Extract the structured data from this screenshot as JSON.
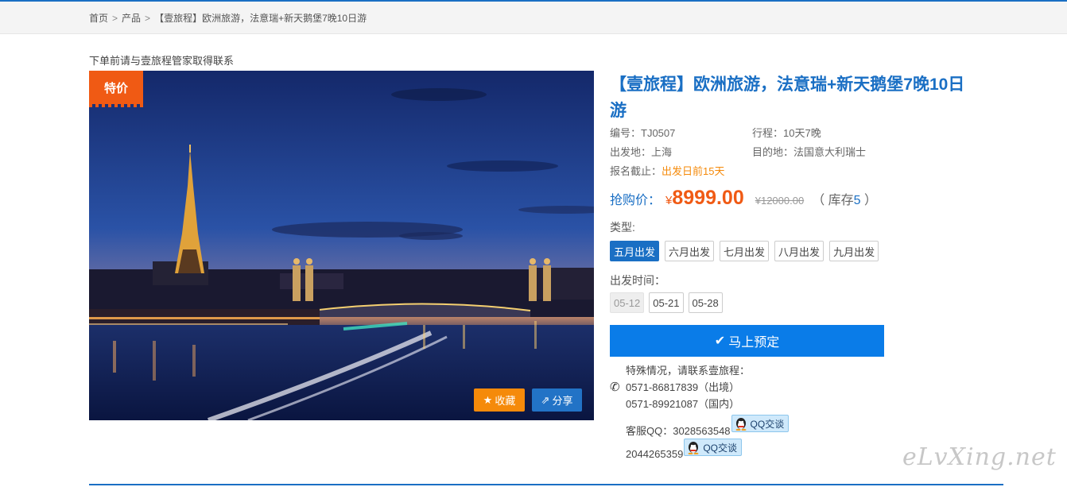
{
  "breadcrumb": {
    "home": "首页",
    "products": "产品",
    "current": "【壹旅程】欧洲旅游，法意瑞+新天鹅堡7晚10日游"
  },
  "notice": "下单前请与壹旅程管家取得联系",
  "image": {
    "tag": "特价",
    "favorite_label": "收藏",
    "share_label": "分享"
  },
  "product": {
    "title": "【壹旅程】欧洲旅游，法意瑞+新天鹅堡7晚10日游",
    "code": "编号：TJ0507",
    "itinerary": "行程：10天7晚",
    "departure": "出发地：上海",
    "destination": "目的地：法国意大利瑞士",
    "deadline_label": "报名截止：",
    "deadline_value": "出发日前15天",
    "price_label": "抢购价：",
    "currency": "¥",
    "price": "8999.00",
    "original_price": "¥12000.00",
    "stock_prefix": "（ 库存",
    "stock_count": "5",
    "stock_suffix": " ）"
  },
  "types": {
    "label": "类型:",
    "options": [
      "五月出发",
      "六月出发",
      "七月出发",
      "八月出发",
      "九月出发"
    ],
    "selected_index": 0
  },
  "dates": {
    "label": "出发时间：",
    "options": [
      "05-12",
      "05-21",
      "05-28"
    ]
  },
  "book_label": "马上预定",
  "contact": {
    "intro": "特殊情况，请联系壹旅程：",
    "phone1": "0571-86817839（出境）",
    "phone2": "0571-89921087（国内）",
    "qq_label": "客服QQ：3028563548",
    "qq2": "2044265359",
    "qq_button": "QQ交谈"
  },
  "watermark": "eLvXing.net",
  "colors": {
    "primary": "#1a6fc4",
    "orange": "#f05a14",
    "book_button": "#0a7ce8"
  }
}
